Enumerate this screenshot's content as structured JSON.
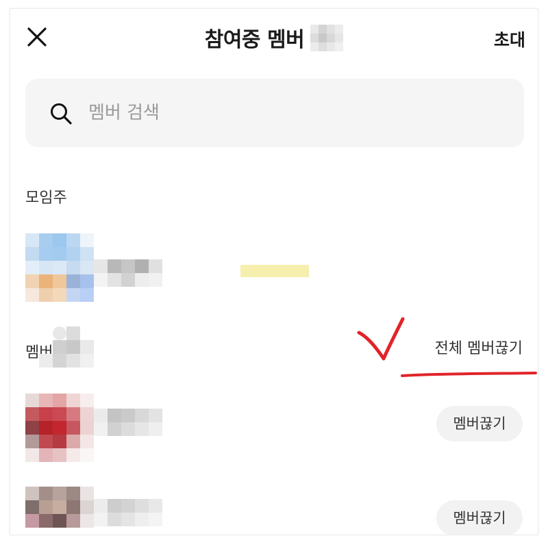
{
  "header": {
    "title": "참여중 멤버",
    "invite_label": "초대"
  },
  "search": {
    "placeholder": "멤버 검색",
    "value": ""
  },
  "sections": {
    "owner_label": "모임주",
    "members_label": "멤버"
  },
  "actions": {
    "kick_all_label": "전체 멤버끊기",
    "kick_label": "멤버끊기"
  },
  "members": [
    {
      "kick_label": "멤버끊기"
    },
    {
      "kick_label": "멤버끊기"
    }
  ],
  "icons": {
    "close": "close-icon",
    "search": "search-icon"
  },
  "colors": {
    "annotation_red": "#e0242a",
    "search_bg": "#f5f5f5",
    "kick_button_bg": "#f2f2f2",
    "highlight_yellow": "#f6efad"
  }
}
